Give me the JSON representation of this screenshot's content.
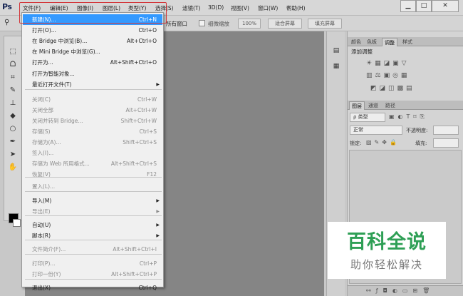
{
  "app": {
    "logo": "Ps"
  },
  "menubar": {
    "items": [
      "文件(F)",
      "编辑(E)",
      "图像(I)",
      "图层(L)",
      "类型(Y)",
      "选择(S)",
      "滤镜(T)",
      "3D(D)",
      "视图(V)",
      "窗口(W)",
      "帮助(H)"
    ]
  },
  "window_controls": {
    "minimize": "▁",
    "restore": "□",
    "close": "✕"
  },
  "options_bar": {
    "all_windows_label": "所有窗口",
    "scrubby_zoom_label": "细微缩放",
    "zoom_value": "100%",
    "fit_screen": "适合屏幕",
    "fill_screen": "填充屏幕"
  },
  "file_menu": {
    "items": [
      {
        "label": "新建(N)...",
        "shortcut": "Ctrl+N",
        "disabled": false,
        "highlighted": true
      },
      {
        "label": "打开(O)...",
        "shortcut": "Ctrl+O",
        "disabled": false
      },
      {
        "label": "在 Bridge 中浏览(B)...",
        "shortcut": "Alt+Ctrl+O",
        "disabled": false
      },
      {
        "label": "在 Mini Bridge 中浏览(G)...",
        "shortcut": "",
        "disabled": false
      },
      {
        "label": "打开为...",
        "shortcut": "Alt+Shift+Ctrl+O",
        "disabled": false
      },
      {
        "label": "打开为智能对象...",
        "shortcut": "",
        "disabled": false
      },
      {
        "label": "最近打开文件(T)",
        "shortcut": "",
        "disabled": false,
        "submenu": true
      },
      {
        "label": "关闭(C)",
        "shortcut": "Ctrl+W",
        "disabled": true
      },
      {
        "label": "关闭全部",
        "shortcut": "Alt+Ctrl+W",
        "disabled": true
      },
      {
        "label": "关闭并转到 Bridge...",
        "shortcut": "Shift+Ctrl+W",
        "disabled": true
      },
      {
        "label": "存储(S)",
        "shortcut": "Ctrl+S",
        "disabled": true
      },
      {
        "label": "存储为(A)...",
        "shortcut": "Shift+Ctrl+S",
        "disabled": true
      },
      {
        "label": "签入(I)...",
        "shortcut": "",
        "disabled": true
      },
      {
        "label": "存储为 Web 所用格式...",
        "shortcut": "Alt+Shift+Ctrl+S",
        "disabled": true
      },
      {
        "label": "恢复(V)",
        "shortcut": "F12",
        "disabled": true
      },
      {
        "label": "置入(L)...",
        "shortcut": "",
        "disabled": true
      },
      {
        "label": "导入(M)",
        "shortcut": "",
        "disabled": false,
        "submenu": true
      },
      {
        "label": "导出(E)",
        "shortcut": "",
        "disabled": true,
        "submenu": true
      },
      {
        "label": "自动(U)",
        "shortcut": "",
        "disabled": false,
        "submenu": true
      },
      {
        "label": "脚本(R)",
        "shortcut": "",
        "disabled": false,
        "submenu": true
      },
      {
        "label": "文件简介(F)...",
        "shortcut": "Alt+Shift+Ctrl+I",
        "disabled": true
      },
      {
        "label": "打印(P)...",
        "shortcut": "Ctrl+P",
        "disabled": true
      },
      {
        "label": "打印一份(Y)",
        "shortcut": "Alt+Shift+Ctrl+P",
        "disabled": true
      },
      {
        "label": "退出(X)",
        "shortcut": "Ctrl+Q",
        "disabled": false
      }
    ]
  },
  "panel_top": {
    "tabs": [
      "颜色",
      "色板",
      "调整",
      "样式"
    ],
    "active_tab": "调整",
    "adjust_label": "添加调整"
  },
  "layers_panel": {
    "tabs": [
      "图层",
      "通道",
      "路径"
    ],
    "filter_label": "ρ 类型",
    "blend_mode": "正常",
    "opacity_label": "不透明度:",
    "lock_label": "锁定:",
    "fill_label": "填充:"
  },
  "watermark": {
    "title": "百科全说",
    "subtitle": "助你轻松解决"
  }
}
